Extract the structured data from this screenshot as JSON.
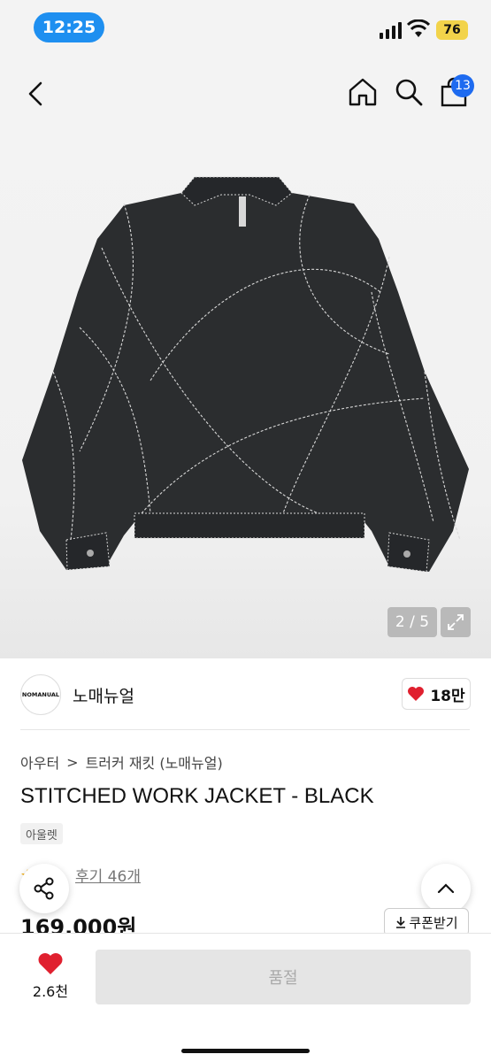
{
  "status_bar": {
    "time": "12:25",
    "battery": "76"
  },
  "header": {
    "cart_count": "13"
  },
  "gallery": {
    "counter": "2 / 5"
  },
  "brand": {
    "logo_text": "NOMANUAL",
    "name": "노매뉴얼",
    "likes": "18만"
  },
  "breadcrumb": {
    "category": "아우터",
    "separator": ">",
    "subcategory": "트러커 재킷 (노매뉴얼)"
  },
  "product": {
    "title": "STITCHED WORK JACKET - BLACK",
    "tag": "아울렛",
    "review_label": "후기 46개",
    "price": "169,000원",
    "coupon_label": "쿠폰받기"
  },
  "bottom_bar": {
    "wish_count": "2.6천",
    "soldout_label": "품절"
  },
  "colors": {
    "accent_blue": "#1e8ff0",
    "heart_red": "#e0202f",
    "battery_yellow": "#f2d34a"
  },
  "icons": [
    "back-arrow-icon",
    "home-icon",
    "search-icon",
    "shopping-bag-icon",
    "expand-icon",
    "heart-icon",
    "share-icon",
    "chevron-up-icon",
    "download-icon",
    "star-icon"
  ]
}
